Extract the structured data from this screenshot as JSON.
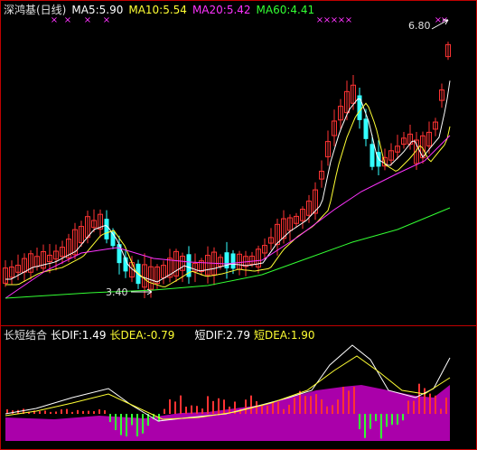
{
  "header": {
    "stock_name": "深鸿基(日线)",
    "ma5": "MA5:5.90",
    "ma10": "MA10:5.54",
    "ma20": "MA20:5.42",
    "ma60": "MA60:4.41"
  },
  "colors": {
    "background": "#000000",
    "frame": "#c00000",
    "up": "#ff3333",
    "down": "#33ffff",
    "ma5": "#ffffff",
    "ma10": "#ffff33",
    "ma20": "#ff33ff",
    "ma60": "#33ff33",
    "marker": "#ff33ff",
    "macd_area": "#aa00aa"
  },
  "annotations": {
    "high_price": "6.80",
    "low_price": "3.40"
  },
  "macd_legend": {
    "title": "长短结合",
    "long_dif": "长DIF:1.49",
    "long_dea": "长DEA:-0.79",
    "short_dif": "短DIF:2.79",
    "short_dea": "短DEA:1.90"
  },
  "icons": [
    "period-marker-icon",
    "arrow-pointer-icon"
  ]
}
